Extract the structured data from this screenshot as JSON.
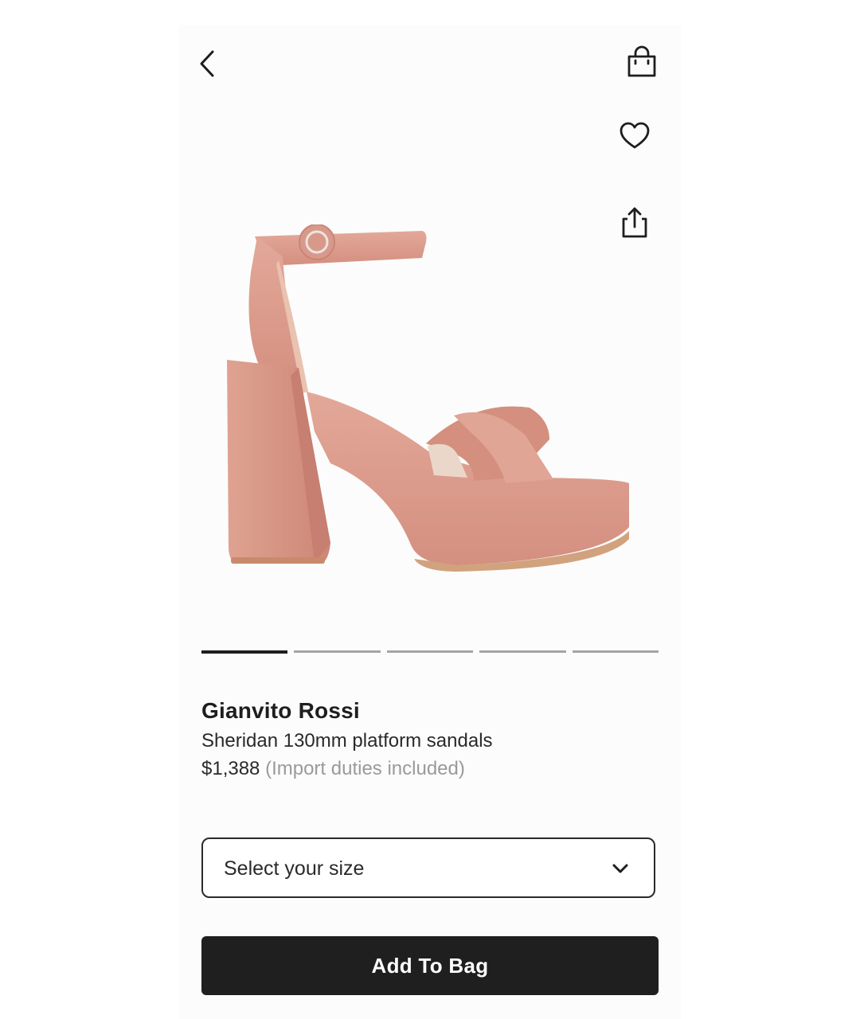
{
  "header": {
    "back_icon": "chevron-left-icon",
    "bag_icon": "shopping-bag-icon",
    "wishlist_icon": "heart-icon",
    "share_icon": "share-icon"
  },
  "product": {
    "image": "pink glitter platform sandal with block heel and ankle strap",
    "gallery_pages": 5,
    "gallery_active_index": 0,
    "brand": "Gianvito Rossi",
    "name": "Sheridan 130mm platform sandals",
    "price": "$1,388",
    "duties_note": "(Import duties included)",
    "color_accent": "#d9998a"
  },
  "size_selector": {
    "label": "Select your size",
    "icon": "chevron-down-icon"
  },
  "actions": {
    "add_to_bag_label": "Add To Bag"
  }
}
